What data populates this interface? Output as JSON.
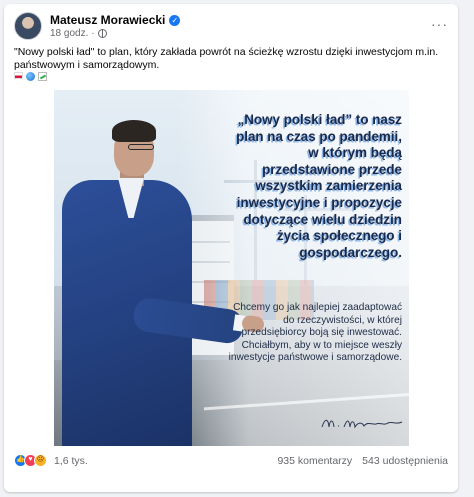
{
  "post": {
    "author": "Mateusz Morawiecki",
    "timestamp": "18 godz.",
    "text": "\"Nowy polski ład\" to plan, który zakłada powrót na ścieżkę wzrostu dzięki inwestycjom m.in. państwowym i samorządowym.",
    "more_label": "···",
    "emojis": [
      "flag-poland",
      "globe",
      "chart-increasing"
    ]
  },
  "image": {
    "quote": "„Nowy polski ład” to nasz plan na czas po pandemii, w którym będą przedstawione przede wszystkim zamierzenia inwestycyjne i propozycje dotyczące wielu dziedzin życia społecznego i gospodarczego.",
    "body": "Chcemy go jak najlepiej zaadaptować do rzeczywistości, w której przedsiębiorcy boją się inwestować. Chciałbym, aby w to miejsce weszły inwestycje państwowe i samorządowe.",
    "signature_text": "M. Morawiecki"
  },
  "footer": {
    "reaction_icons": [
      "like",
      "love",
      "angry"
    ],
    "reactions_count": "1,6 tys.",
    "comments": "935 komentarzy",
    "shares": "543 udostępnienia"
  },
  "colors": {
    "accent": "#1877f2",
    "secondary_text": "#65676b",
    "quote_text": "#1a2a4a",
    "quote_shadow": "#8fb6e8",
    "suit": "#23407f"
  }
}
